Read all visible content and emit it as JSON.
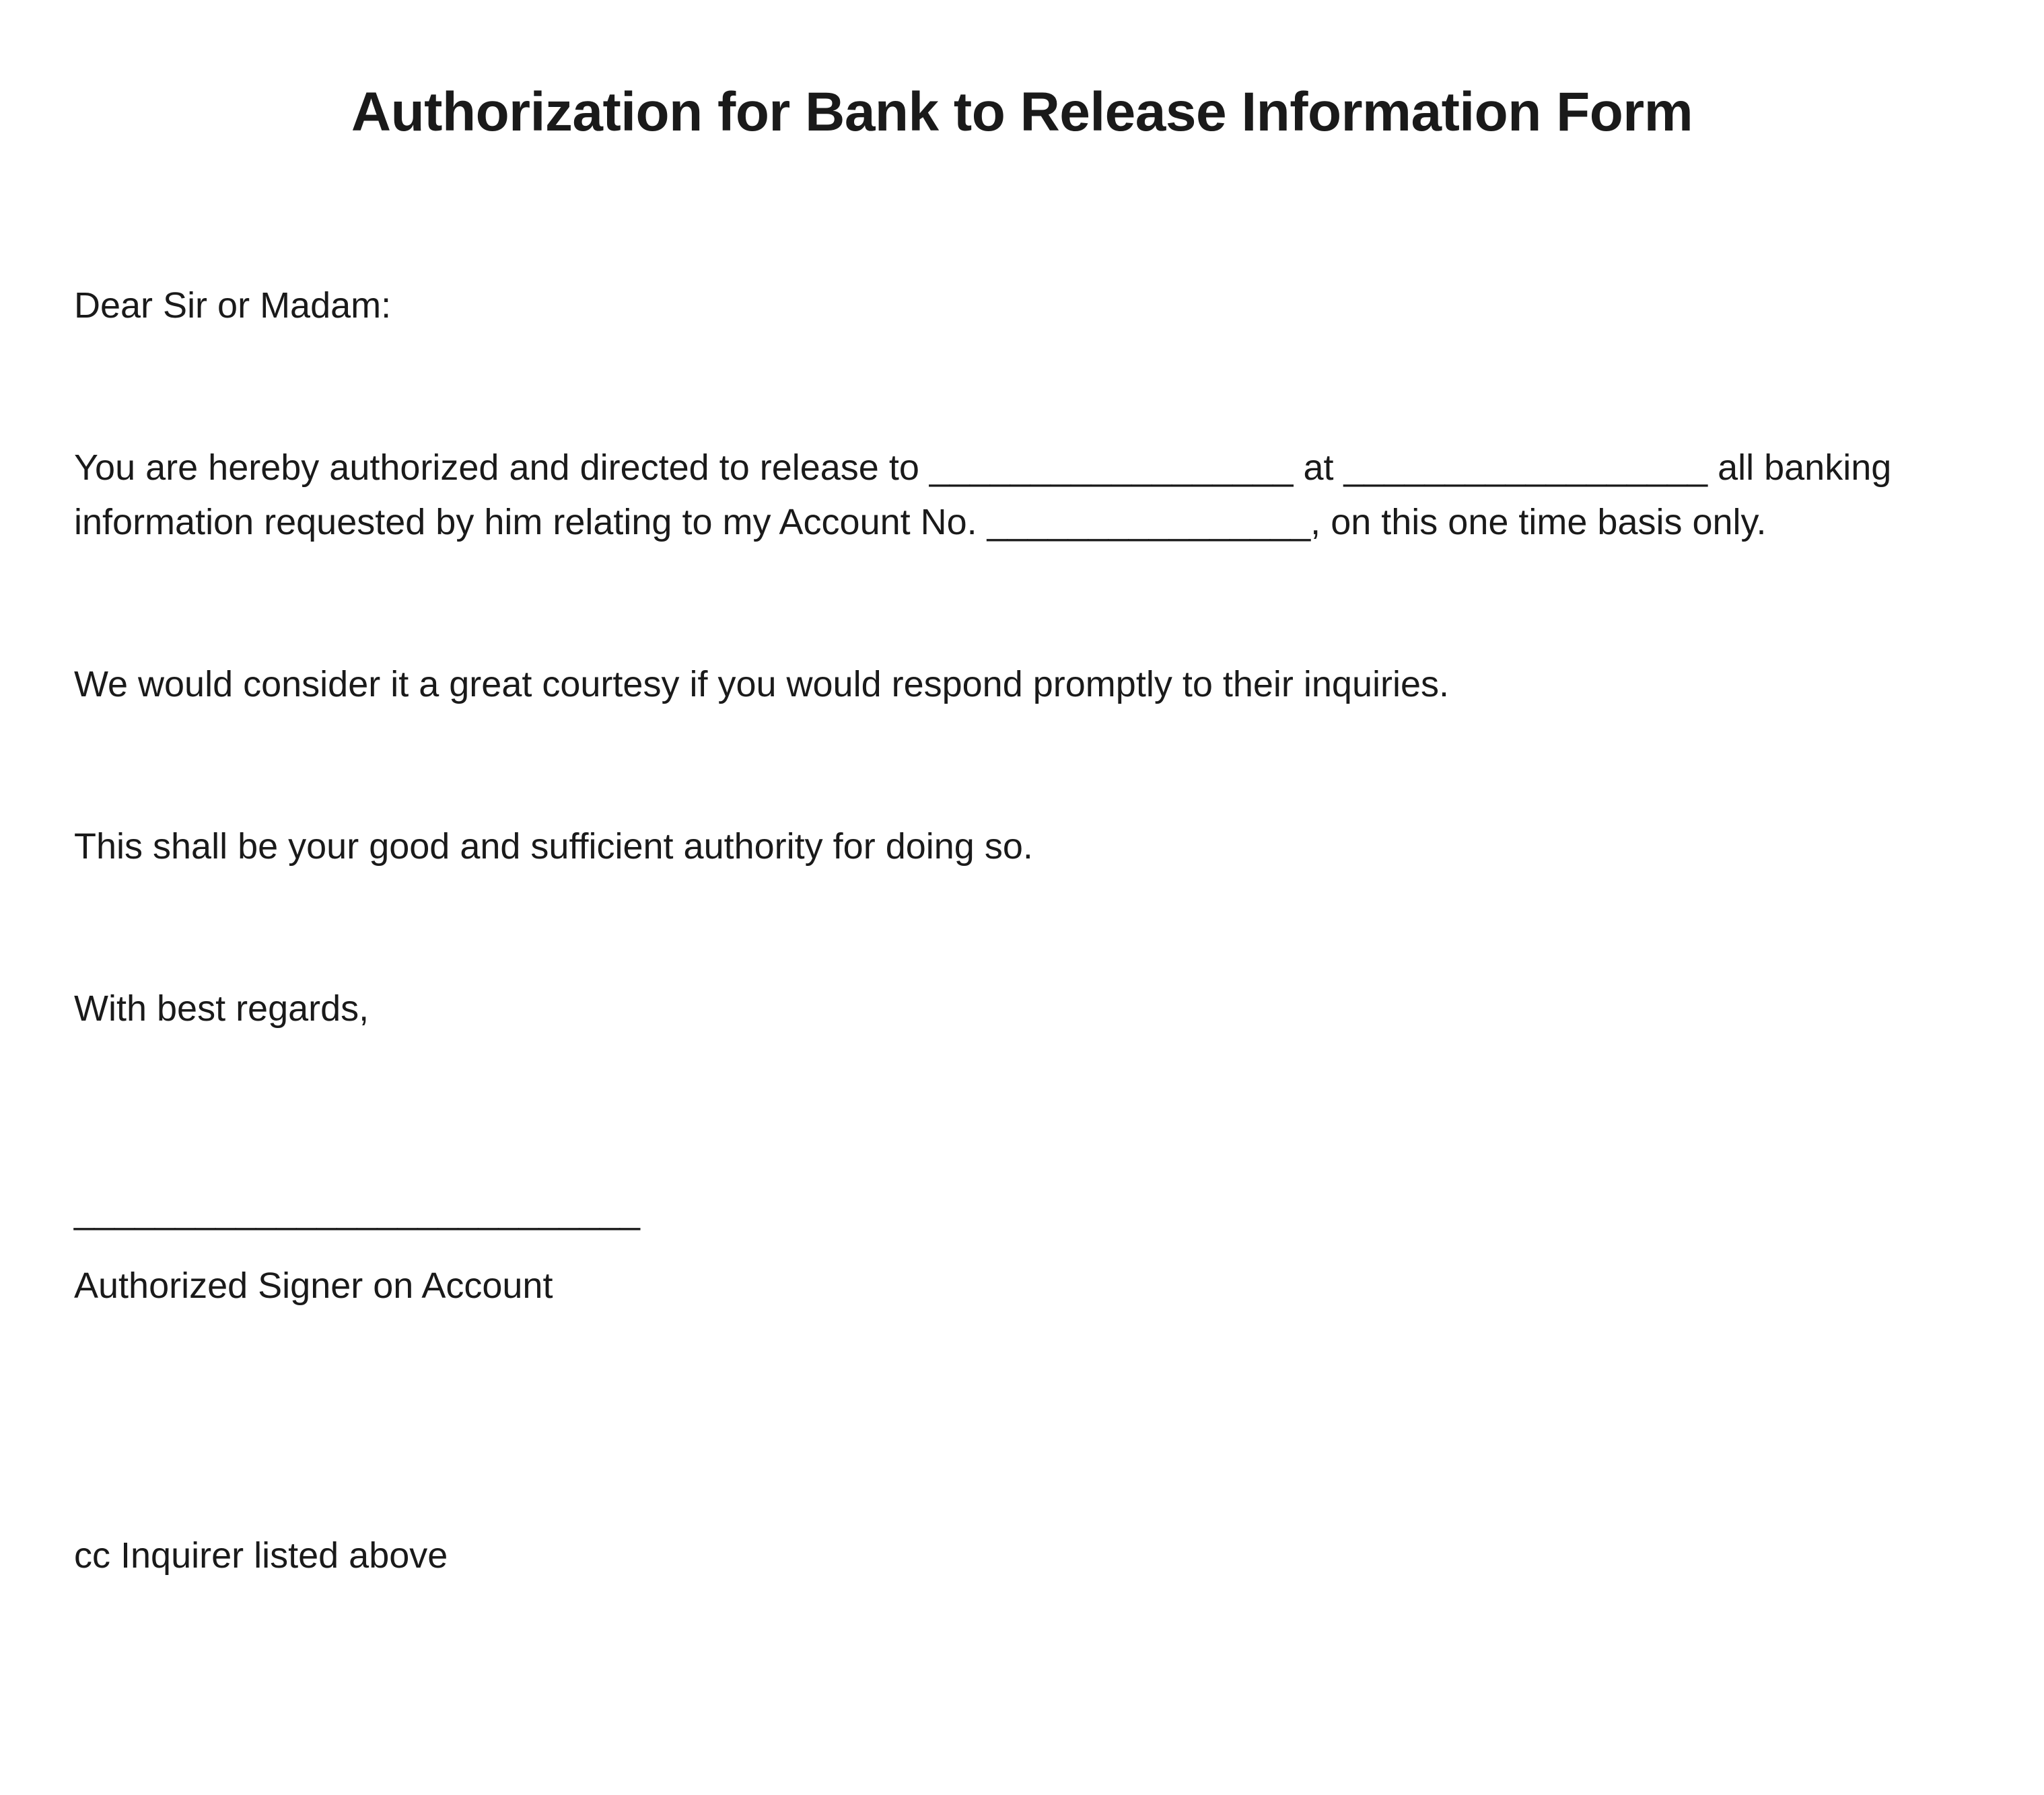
{
  "title": "Authorization for Bank to Release Information Form",
  "salutation": "Dear Sir or Madam:",
  "paragraph1": "You are hereby authorized and directed to release to __________________ at __________________ all banking information requested by him relating to my Account No. ________________, on this one time basis only.",
  "paragraph2": "We would consider it a great courtesy if you would respond promptly to their inquiries.",
  "paragraph3": "This shall be your good and sufficient authority for doing so.",
  "closing": "With best regards,",
  "signature_line": "____________________________",
  "signature_label": "Authorized Signer on Account",
  "cc": "cc Inquirer listed above"
}
